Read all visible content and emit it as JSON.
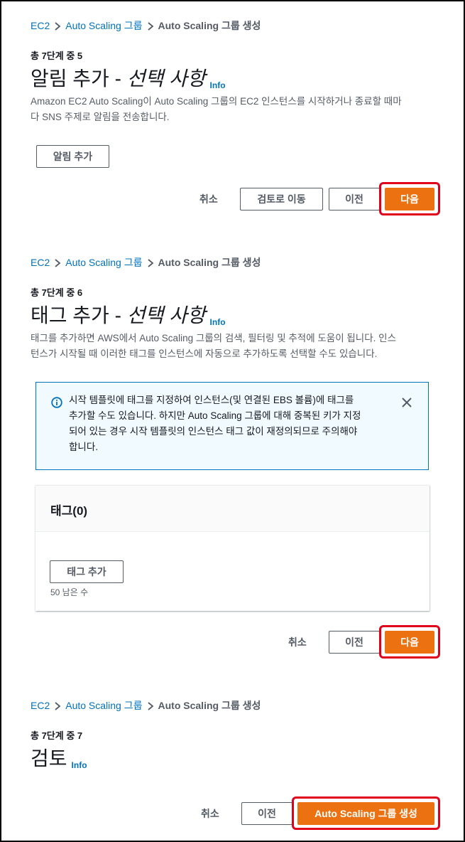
{
  "sections": [
    {
      "breadcrumb": [
        "EC2",
        "Auto Scaling 그룹",
        "Auto Scaling 그룹 생성"
      ],
      "step": "총 7단계 중 5",
      "title_main": "알림 추가 - ",
      "title_optional": "선택 사항",
      "info": "Info",
      "description": [
        "Amazon EC2 Auto Scaling이 Auto Scaling 그룹의 EC2 인스턴스를 시작하거나 종료할 때마",
        "다 SNS 주제로 알림을 전송합니다."
      ],
      "add_button": "알림 추가",
      "footer": {
        "cancel": "취소",
        "review": "검토로 이동",
        "previous": "이전",
        "next": "다음"
      }
    },
    {
      "breadcrumb": [
        "EC2",
        "Auto Scaling 그룹",
        "Auto Scaling 그룹 생성"
      ],
      "step": "총 7단계 중 6",
      "title_main": "태그 추가 - ",
      "title_optional": "선택 사항",
      "info": "Info",
      "description": [
        "태그를 추가하면 AWS에서 Auto Scaling 그룹의 검색, 필터링 및 추적에 도움이 됩니다. 인스",
        "턴스가 시작될 때 이러한 태그를 인스턴스에 자동으로 추가하도록 선택할 수도 있습니다."
      ],
      "alert": [
        "시작 템플릿에 태그를 지정하여 인스턴스(및 연결된 EBS 볼륨)에 태그를",
        "추가할 수도 있습니다. 하지만 Auto Scaling 그룹에 대해 중복된 키가 지정",
        "되어 있는 경우 시작 템플릿의 인스턴스 태그 값이 재정의되므로 주의해야",
        "합니다."
      ],
      "panel_title": "태그(0)",
      "add_button": "태그 추가",
      "remaining": "50 남은 수",
      "footer": {
        "cancel": "취소",
        "previous": "이전",
        "next": "다음"
      }
    },
    {
      "breadcrumb": [
        "EC2",
        "Auto Scaling 그룹",
        "Auto Scaling 그룹 생성"
      ],
      "step": "총 7단계 중 7",
      "title_main": "검토",
      "info": "Info",
      "footer": {
        "cancel": "취소",
        "previous": "이전",
        "create": "Auto Scaling 그룹 생성"
      }
    }
  ],
  "colors": {
    "primary": "#ec7211",
    "link": "#0073bb",
    "highlight": "#e0001b",
    "alert_bg": "#f1faff"
  }
}
